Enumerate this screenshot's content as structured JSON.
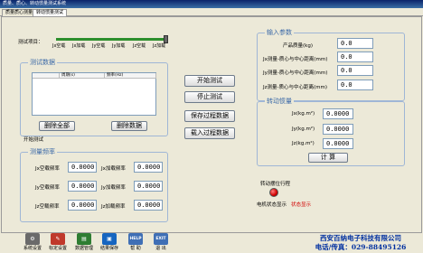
{
  "window": {
    "title": "质量、质心、转动惯量测试系统"
  },
  "tabs": [
    {
      "label": "质量质心测量"
    },
    {
      "label": "转动惯量测试"
    }
  ],
  "test_selector": {
    "label": "测试项目：",
    "ticks": [
      "Jx空载",
      "Jx加载",
      "Jy空载",
      "Jy加载",
      "Jz空载",
      "Jz加载"
    ],
    "selected_index": 5
  },
  "test_data": {
    "title": "测试数据",
    "columns": [
      "周期(s)",
      "频率(Hz)"
    ],
    "delete_all": "删除全部",
    "delete_data": "删除数据",
    "status": "开始测试"
  },
  "measure_freq": {
    "title": "测量频率",
    "rows": [
      {
        "left_label": "Jx空载频率",
        "left_value": "0.0000",
        "right_label": "Jx加载频率",
        "right_value": "0.0000"
      },
      {
        "left_label": "Jy空载频率",
        "left_value": "0.0000",
        "right_label": "Jy加载频率",
        "right_value": "0.0000"
      },
      {
        "left_label": "Jz空载频率",
        "left_value": "0.0000",
        "right_label": "Jz加载频率",
        "right_value": "0.0000"
      }
    ]
  },
  "actions": {
    "start": "开始测试",
    "stop": "停止测试",
    "save": "保存过程数据",
    "load": "载入过程数据"
  },
  "input_params": {
    "title": "输入参数",
    "rows": [
      {
        "label": "产品质量(kg)",
        "value": "0.0"
      },
      {
        "label": "Jx测量-质心与中心距离(mm)",
        "value": "0.0"
      },
      {
        "label": "Jy测量-质心与中心距离(mm)",
        "value": "0.0"
      },
      {
        "label": "Jz测量-质心与中心距离(mm)",
        "value": "0.0"
      }
    ]
  },
  "inertia": {
    "title": "转动惯量",
    "rows": [
      {
        "label": "Jx(kg.m²)",
        "value": "0.0000"
      },
      {
        "label": "Jy(kg.m²)",
        "value": "0.0000"
      },
      {
        "label": "Jz(kg.m²)",
        "value": "0.0000"
      }
    ],
    "calc": "计 算"
  },
  "status": {
    "pendulum_label": "转动摆位行程",
    "motor_label": "电机状态显示",
    "motor_value": "状态显示"
  },
  "footer": {
    "buttons": [
      {
        "label": "系统设置",
        "icon": "gear-icon",
        "color": "#6a6a6a",
        "glyph": "⚙"
      },
      {
        "label": "标定设置",
        "icon": "pencil-icon",
        "color": "#c0392b",
        "glyph": "✎"
      },
      {
        "label": "数据管理",
        "icon": "database-icon",
        "color": "#2e7d32",
        "glyph": "▤"
      },
      {
        "label": "结果保存",
        "icon": "save-icon",
        "color": "#1565c0",
        "glyph": "▣"
      },
      {
        "label": "帮 助",
        "icon": "help-icon",
        "color": "#3f6fb5",
        "glyph": "HELP"
      },
      {
        "label": "退 出",
        "icon": "exit-icon",
        "color": "#3f6fb5",
        "glyph": "EXIT"
      }
    ],
    "company": "西安百纳电子科技有限公司",
    "contact": "电话/传真：029-88495126"
  }
}
